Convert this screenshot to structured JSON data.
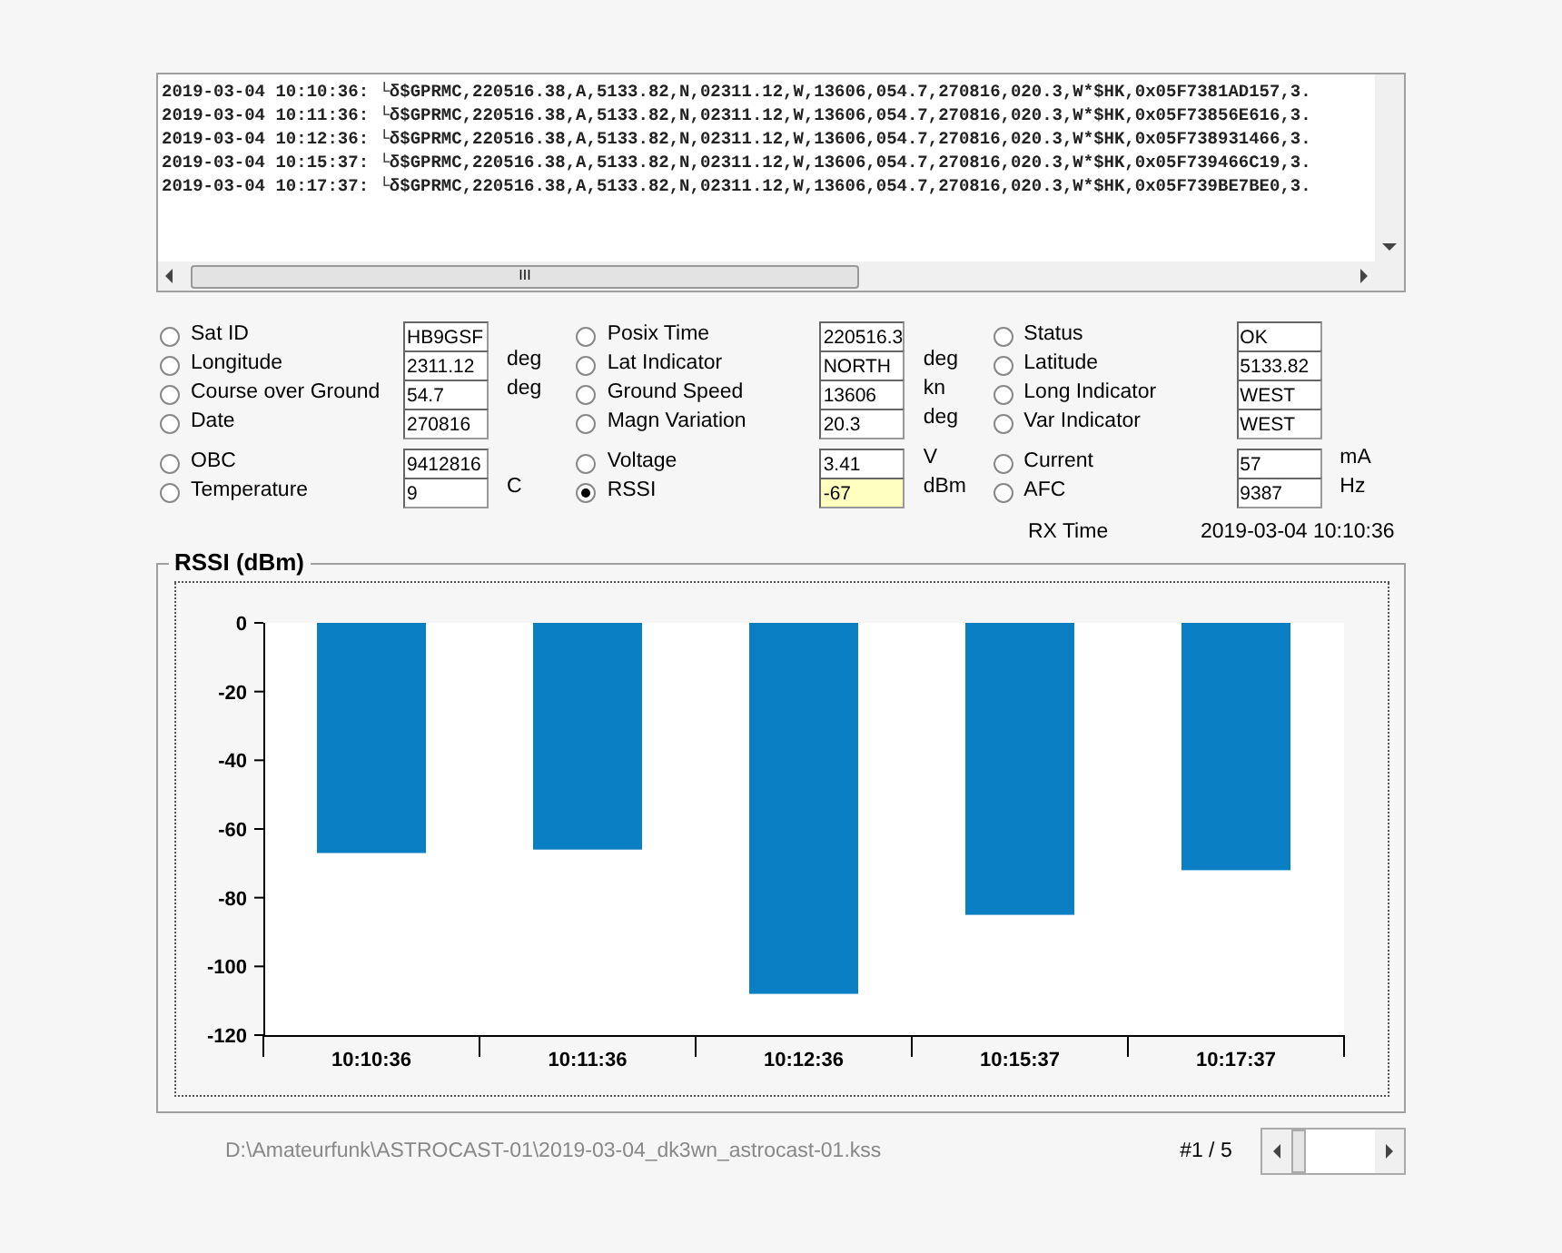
{
  "log": {
    "lines": [
      "2019-03-04 10:10:36: └δ$GPRMC,220516.38,A,5133.82,N,02311.12,W,13606,054.7,270816,020.3,W*$HK,0x05F7381AD157,3.",
      "2019-03-04 10:11:36: └δ$GPRMC,220516.38,A,5133.82,N,02311.12,W,13606,054.7,270816,020.3,W*$HK,0x05F73856E616,3.",
      "2019-03-04 10:12:36: └δ$GPRMC,220516.38,A,5133.82,N,02311.12,W,13606,054.7,270816,020.3,W*$HK,0x05F738931466,3.",
      "2019-03-04 10:15:37: └δ$GPRMC,220516.38,A,5133.82,N,02311.12,W,13606,054.7,270816,020.3,W*$HK,0x05F739466C19,3.",
      "2019-03-04 10:17:37: └δ$GPRMC,220516.38,A,5133.82,N,02311.12,W,13606,054.7,270816,020.3,W*$HK,0x05F739BE7BE0,3."
    ],
    "scroll_grip": "III"
  },
  "field_blocks": [
    {
      "rows": [
        [
          {
            "label": "Sat ID",
            "value": "HB9GSF",
            "selected": false
          },
          {
            "label": "Posix Time",
            "value": "220516.3",
            "selected": false
          },
          {
            "label": "Status",
            "value": "OK",
            "selected": false
          }
        ],
        [
          {
            "label": "Longitude",
            "value": "2311.12",
            "unit": "deg",
            "selected": false
          },
          {
            "label": "Lat Indicator",
            "value": "NORTH",
            "unit": "deg",
            "selected": false
          },
          {
            "label": "Latitude",
            "value": "5133.82",
            "selected": false
          }
        ],
        [
          {
            "label": "Course over Ground",
            "value": "54.7",
            "unit": "deg",
            "selected": false
          },
          {
            "label": "Ground Speed",
            "value": "13606",
            "unit": "kn",
            "selected": false
          },
          {
            "label": "Long Indicator",
            "value": "WEST",
            "selected": false
          }
        ],
        [
          {
            "label": "Date",
            "value": "270816",
            "selected": false
          },
          {
            "label": "Magn Variation",
            "value": "20.3",
            "unit": "deg",
            "selected": false
          },
          {
            "label": "Var Indicator",
            "value": "WEST",
            "selected": false
          }
        ]
      ]
    },
    {
      "rows": [
        [
          {
            "label": "OBC",
            "value": "9412816",
            "selected": false
          },
          {
            "label": "Voltage",
            "value": "3.41",
            "unit": "V",
            "selected": false
          },
          {
            "label": "Current",
            "value": "57",
            "unit": "mA",
            "selected": false
          }
        ],
        [
          {
            "label": "Temperature",
            "value": "9",
            "unit": "C",
            "selected": false
          },
          {
            "label": "RSSI",
            "value": "-67",
            "unit": "dBm",
            "selected": true
          },
          {
            "label": "AFC",
            "value": "9387",
            "unit": "Hz",
            "selected": false
          }
        ]
      ]
    }
  ],
  "rx_time": {
    "label": "RX Time",
    "value": "2019-03-04 10:10:36"
  },
  "chart_panel": {
    "title": "RSSI (dBm)",
    "chart_data": {
      "type": "bar",
      "categories": [
        "10:10:36",
        "10:11:36",
        "10:12:36",
        "10:15:37",
        "10:17:37"
      ],
      "series": [
        {
          "color": "#0a7fc4",
          "values": [
            -67,
            -66,
            -108,
            -85,
            -72
          ]
        }
      ],
      "ylim": [
        -120,
        0
      ],
      "yticks": [
        0,
        -20,
        -40,
        -60,
        -80,
        -100,
        -120
      ]
    }
  },
  "file_path": "D:\\Amateurfunk\\ASTROCAST-01\\2019-03-04_dk3wn_astrocast-01.kss",
  "record_counter": "#1 / 5"
}
